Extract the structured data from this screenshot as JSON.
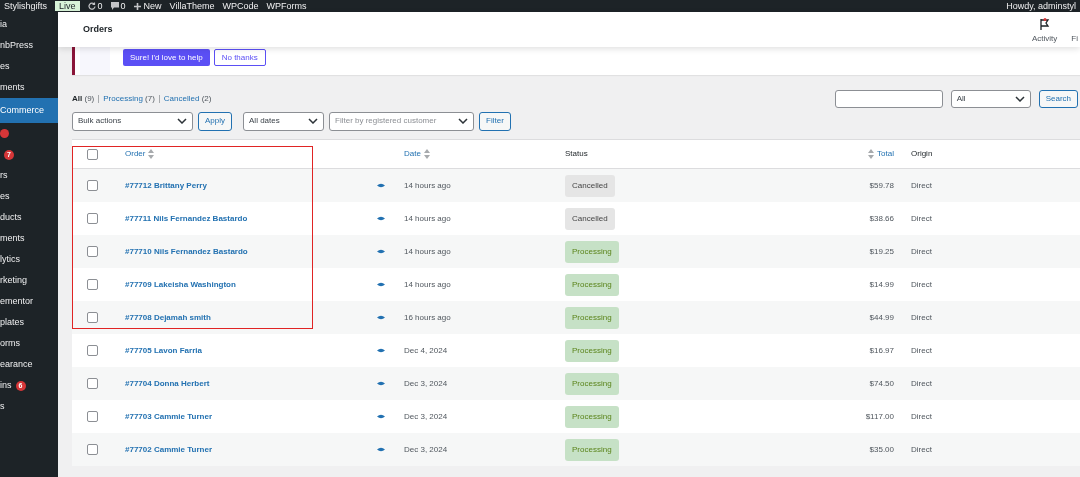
{
  "admin_bar": {
    "site": "Stylishgifts",
    "site_badge": "Live",
    "updates": "0",
    "comments": "0",
    "items": [
      "New",
      "VillaTheme",
      "WPCode",
      "WPForms"
    ],
    "greeting": "Howdy, adminstyl"
  },
  "sidebar": {
    "items": [
      {
        "label": "ia",
        "selected": false
      },
      {
        "label": "nbPress",
        "selected": false
      },
      {
        "label": "es",
        "selected": false
      },
      {
        "label": "ments",
        "selected": false
      },
      {
        "label": "Commerce",
        "selected": true
      },
      {
        "dot": true,
        "selected": false
      },
      {
        "badge": "7",
        "selected": false
      },
      {
        "label": "rs",
        "selected": false
      },
      {
        "label": "es",
        "selected": false
      },
      {
        "label": "ducts",
        "selected": false
      },
      {
        "label": "ments",
        "selected": false
      },
      {
        "label": "lytics",
        "selected": false
      },
      {
        "label": "rketing",
        "selected": false
      },
      {
        "label": "ementor",
        "selected": false
      },
      {
        "label": "plates",
        "selected": false
      },
      {
        "label": "orms",
        "selected": false
      },
      {
        "label": "earance",
        "selected": false
      },
      {
        "label": "ins",
        "badge": "6",
        "selected": false
      },
      {
        "label": "s",
        "selected": false
      }
    ]
  },
  "header": {
    "title": "Orders",
    "actions": [
      "Activity",
      "Fi"
    ]
  },
  "notice": {
    "buttons": [
      "Sure! I'd love to help",
      "No thanks"
    ]
  },
  "views": [
    {
      "label": "All",
      "count": "(9)",
      "selected": true
    },
    {
      "label": "Processing",
      "count": "(7)",
      "selected": false
    },
    {
      "label": "Cancelled",
      "count": "(2)",
      "selected": false
    }
  ],
  "search": {
    "type_select": "All",
    "button": "Search"
  },
  "filters": {
    "bulk_actions": "Bulk actions",
    "apply": "Apply",
    "dates": "All dates",
    "customer_placeholder": "Filter by registered customer",
    "filter": "Filter"
  },
  "table": {
    "select_all_checked": false,
    "columns": {
      "order": "Order",
      "date": "Date",
      "status": "Status",
      "total": "Total",
      "origin": "Origin"
    },
    "rows": [
      {
        "order": "#77712 Brittany Perry",
        "date": "14 hours ago",
        "status": "Cancelled",
        "kind": "cancelled",
        "total": "$59.78",
        "origin": "Direct",
        "checked": false
      },
      {
        "order": "#77711 Nils Fernandez Bastardo",
        "date": "14 hours ago",
        "status": "Cancelled",
        "kind": "cancelled",
        "total": "$38.66",
        "origin": "Direct",
        "checked": false
      },
      {
        "order": "#77710 Nils Fernandez Bastardo",
        "date": "14 hours ago",
        "status": "Processing",
        "kind": "processing",
        "total": "$19.25",
        "origin": "Direct",
        "checked": false
      },
      {
        "order": "#77709 Lakeisha Washington",
        "date": "14 hours ago",
        "status": "Processing",
        "kind": "processing",
        "total": "$14.99",
        "origin": "Direct",
        "checked": false
      },
      {
        "order": "#77708 Dejamah smith",
        "date": "16 hours ago",
        "status": "Processing",
        "kind": "processing",
        "total": "$44.99",
        "origin": "Direct",
        "checked": false
      },
      {
        "order": "#77705 Lavon Farria",
        "date": "Dec 4, 2024",
        "status": "Processing",
        "kind": "processing",
        "total": "$16.97",
        "origin": "Direct",
        "checked": false
      },
      {
        "order": "#77704 Donna Herbert",
        "date": "Dec 3, 2024",
        "status": "Processing",
        "kind": "processing",
        "total": "$74.50",
        "origin": "Direct",
        "checked": false
      },
      {
        "order": "#77703 Cammie Turner",
        "date": "Dec 3, 2024",
        "status": "Processing",
        "kind": "processing",
        "total": "$117.00",
        "origin": "Direct",
        "checked": false
      },
      {
        "order": "#77702 Cammie Turner",
        "date": "Dec 3, 2024",
        "status": "Processing",
        "kind": "processing",
        "total": "$35.00",
        "origin": "Direct",
        "checked": false
      }
    ]
  }
}
